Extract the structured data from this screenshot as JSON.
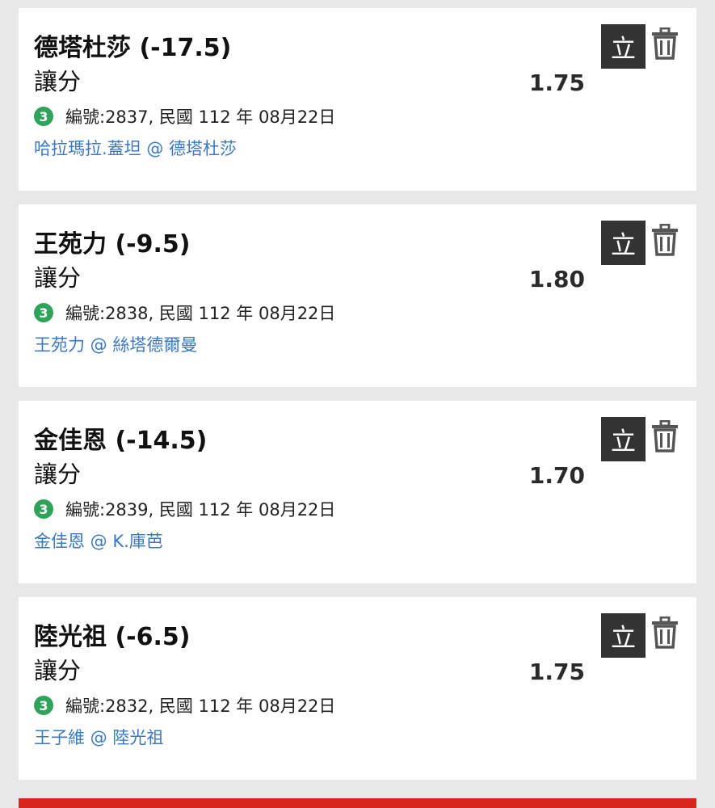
{
  "bets": [
    {
      "title": "德塔杜莎 (-17.5)",
      "bet_type": "讓分",
      "odds": "1.75",
      "badge": "3",
      "info": "編號:2837, 民國 112 年 08月22日",
      "matchup": "哈拉瑪拉.蓋坦 @ 德塔杜莎",
      "stake_label": "立"
    },
    {
      "title": "王苑力 (-9.5)",
      "bet_type": "讓分",
      "odds": "1.80",
      "badge": "3",
      "info": "編號:2838, 民國 112 年 08月22日",
      "matchup": "王苑力 @ 絲塔德爾曼",
      "stake_label": "立"
    },
    {
      "title": "金佳恩 (-14.5)",
      "bet_type": "讓分",
      "odds": "1.70",
      "badge": "3",
      "info": "編號:2839, 民國 112 年 08月22日",
      "matchup": "金佳恩 @ K.庫芭",
      "stake_label": "立"
    },
    {
      "title": "陸光祖 (-6.5)",
      "bet_type": "讓分",
      "odds": "1.75",
      "badge": "3",
      "info": "編號:2832, 民國 112 年 08月22日",
      "matchup": "王子維 @ 陸光祖",
      "stake_label": "立"
    }
  ],
  "icons": {
    "delete": "trash-icon",
    "badge": "number-badge"
  },
  "colors": {
    "accent_red": "#d9261c",
    "link_blue": "#3b78c2",
    "badge_green": "#2fa35a"
  }
}
